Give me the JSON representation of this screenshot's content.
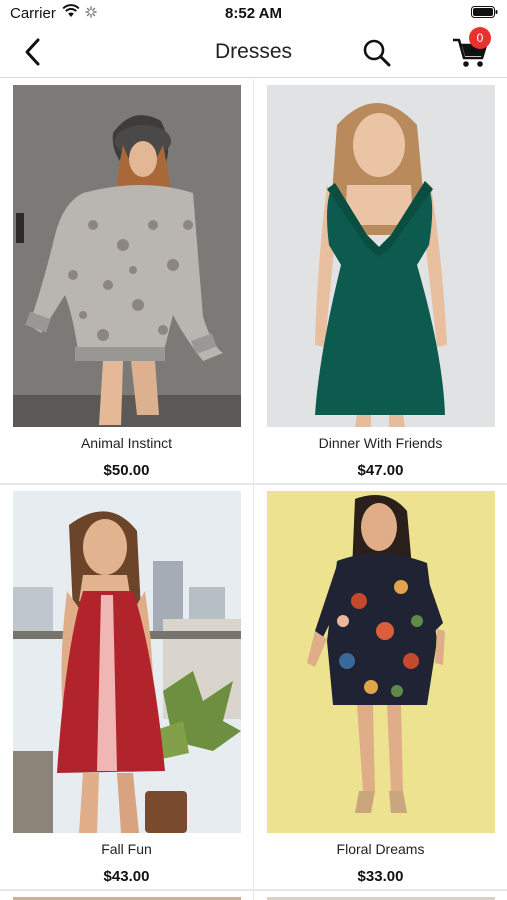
{
  "status_bar": {
    "carrier": "Carrier",
    "time": "8:52 AM"
  },
  "nav": {
    "title": "Dresses",
    "cart_count": "0",
    "badge_color": "#e8322f"
  },
  "products": [
    {
      "name": "Animal Instinct",
      "price": "$50.00"
    },
    {
      "name": "Dinner With Friends",
      "price": "$47.00"
    },
    {
      "name": "Fall Fun",
      "price": "$43.00"
    },
    {
      "name": "Floral Dreams",
      "price": "$33.00"
    }
  ]
}
